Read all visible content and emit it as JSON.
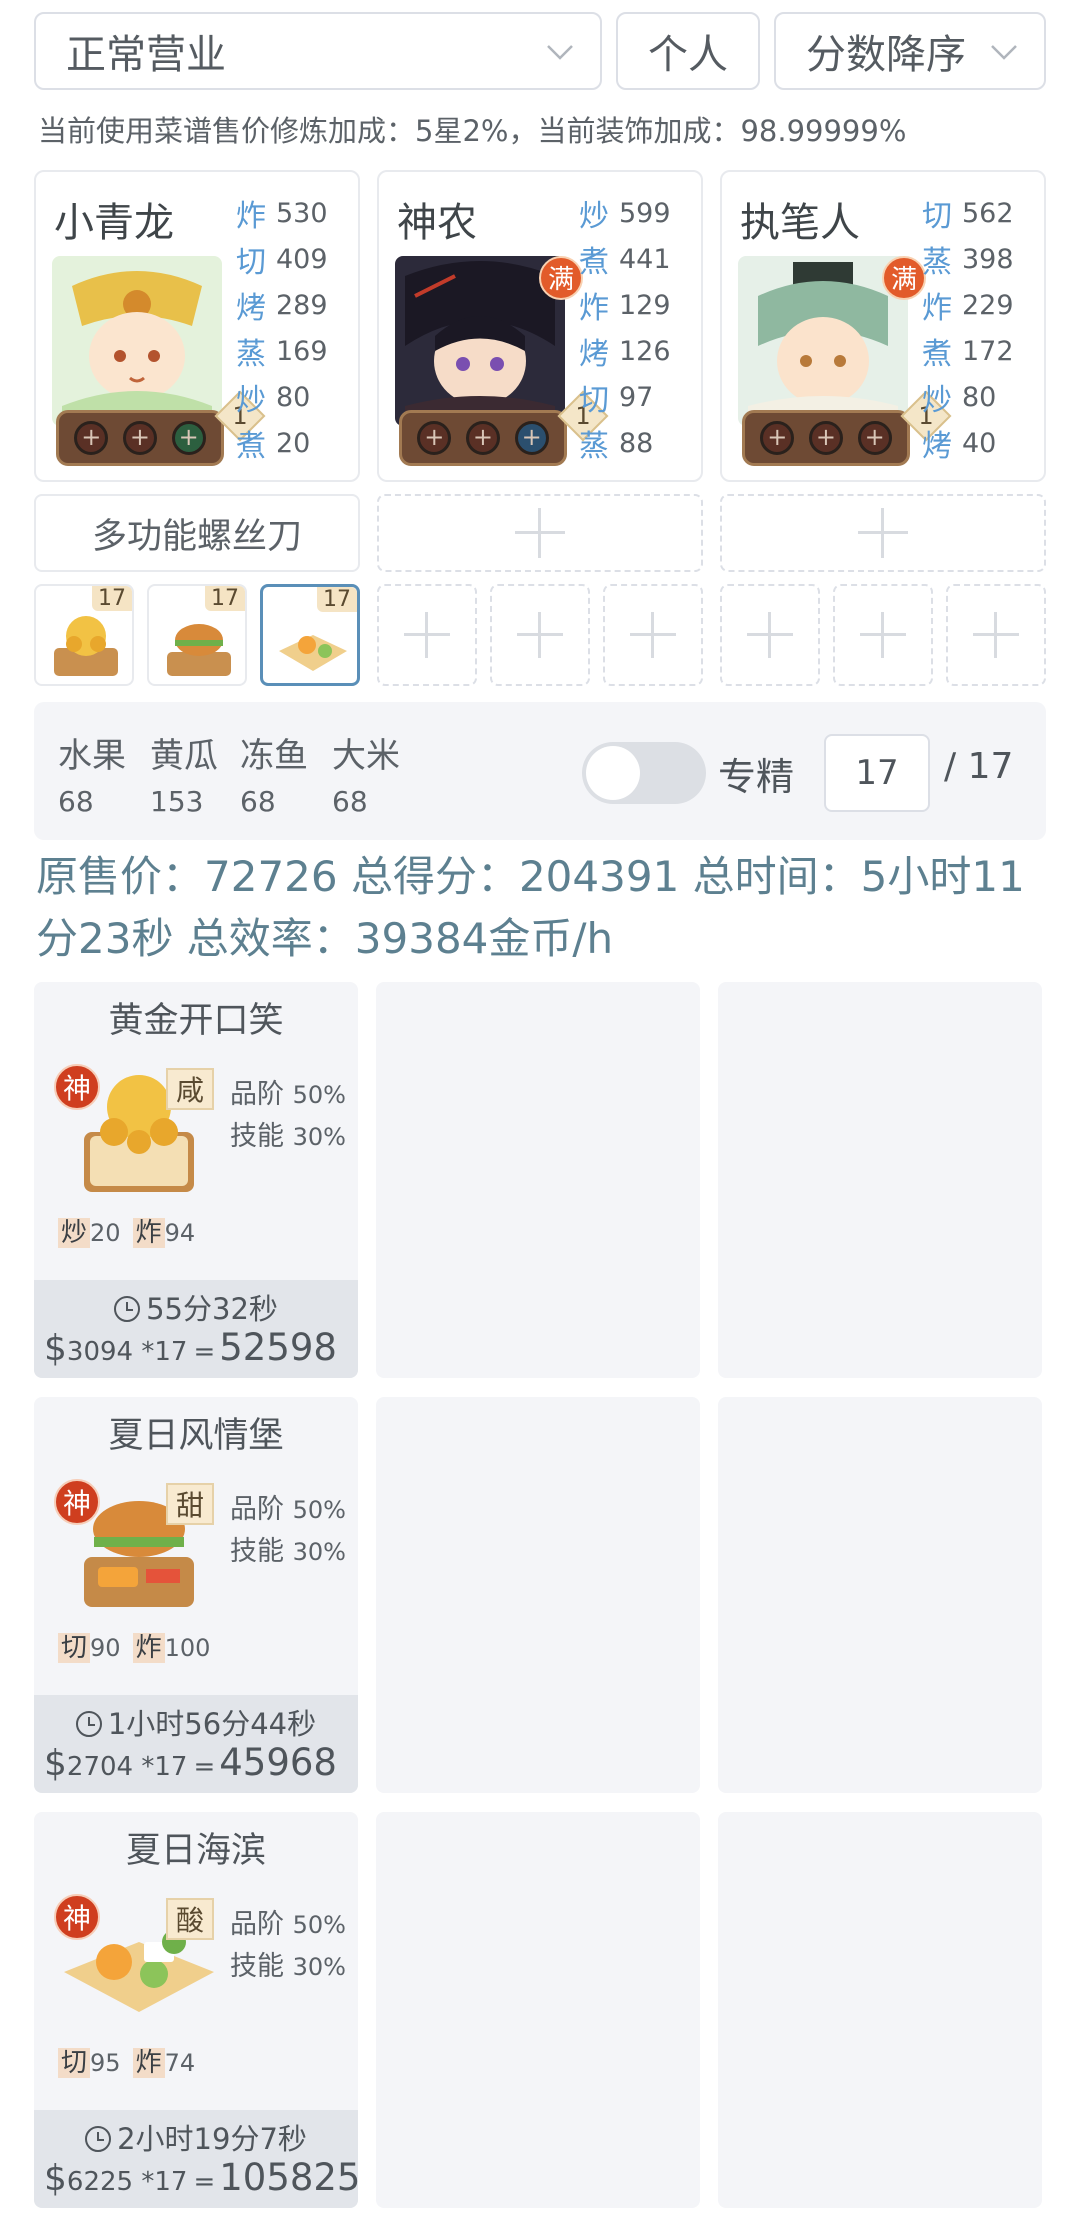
{
  "toolbar": {
    "status_select": "正常营业",
    "mode_button": "个人",
    "sort_select": "分数降序"
  },
  "bonus_text": "当前使用菜谱售价修炼加成：5星2%，当前装饰加成：98.99999%",
  "chefs": [
    {
      "name": "小青龙",
      "full_badge": "",
      "level": "1",
      "skills": [
        {
          "k": "炸",
          "v": "530"
        },
        {
          "k": "切",
          "v": "409"
        },
        {
          "k": "烤",
          "v": "289"
        },
        {
          "k": "蒸",
          "v": "169"
        },
        {
          "k": "炒",
          "v": "80"
        },
        {
          "k": "煮",
          "v": "20"
        }
      ],
      "equipment": "多功能螺丝刀"
    },
    {
      "name": "神农",
      "full_badge": "满",
      "level": "1",
      "skills": [
        {
          "k": "炒",
          "v": "599"
        },
        {
          "k": "煮",
          "v": "441"
        },
        {
          "k": "炸",
          "v": "129"
        },
        {
          "k": "烤",
          "v": "126"
        },
        {
          "k": "切",
          "v": "97"
        },
        {
          "k": "蒸",
          "v": "88"
        }
      ],
      "equipment": ""
    },
    {
      "name": "执笔人",
      "full_badge": "满",
      "level": "1",
      "skills": [
        {
          "k": "切",
          "v": "562"
        },
        {
          "k": "蒸",
          "v": "398"
        },
        {
          "k": "炸",
          "v": "229"
        },
        {
          "k": "煮",
          "v": "172"
        },
        {
          "k": "炒",
          "v": "80"
        },
        {
          "k": "烤",
          "v": "40"
        }
      ],
      "equipment": ""
    }
  ],
  "recipe_slots": [
    "17",
    "17",
    "17"
  ],
  "materials": [
    {
      "name": "水果",
      "value": "68"
    },
    {
      "name": "黄瓜",
      "value": "153"
    },
    {
      "name": "冻鱼",
      "value": "68"
    },
    {
      "name": "大米",
      "value": "68"
    }
  ],
  "exclusive": {
    "label": "专精",
    "toggle_on": false,
    "level_value": "17",
    "level_max": "/ 17"
  },
  "summary": "原售价：72726 总得分：204391 总时间：5小时11分23秒 总效率：39384金币/h",
  "dishes": [
    {
      "name": "黄金开口笑",
      "rank_badge": "神",
      "flavor": "咸",
      "grade_label": "品阶",
      "grade_value": "50%",
      "skill_label": "技能",
      "skill_value": "30%",
      "reqs": [
        {
          "k": "炒",
          "v": "20"
        },
        {
          "k": "炸",
          "v": "94"
        }
      ],
      "time": "55分32秒",
      "unit_price": "3094 *17",
      "total": "52598"
    },
    {
      "name": "夏日风情堡",
      "rank_badge": "神",
      "flavor": "甜",
      "grade_label": "品阶",
      "grade_value": "50%",
      "skill_label": "技能",
      "skill_value": "30%",
      "reqs": [
        {
          "k": "切",
          "v": "90"
        },
        {
          "k": "炸",
          "v": "100"
        }
      ],
      "time": "1小时56分44秒",
      "unit_price": "2704 *17",
      "total": "45968"
    },
    {
      "name": "夏日海滨",
      "rank_badge": "神",
      "flavor": "酸",
      "grade_label": "品阶",
      "grade_value": "50%",
      "skill_label": "技能",
      "skill_value": "30%",
      "reqs": [
        {
          "k": "切",
          "v": "95"
        },
        {
          "k": "炸",
          "v": "74"
        }
      ],
      "time": "2小时19分7秒",
      "unit_price": "6225 *17",
      "total": "105825"
    }
  ],
  "currency_symbol": "$",
  "equals_sign": "="
}
